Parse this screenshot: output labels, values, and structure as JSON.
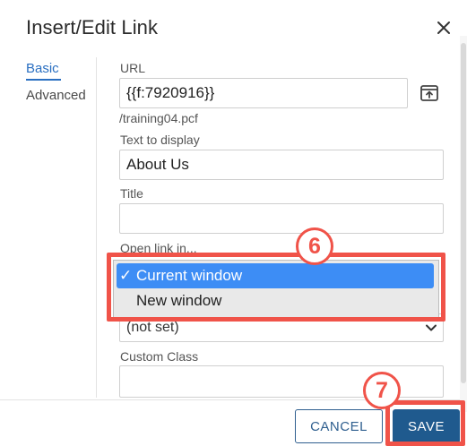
{
  "dialog": {
    "title": "Insert/Edit Link",
    "close_icon": "close-icon"
  },
  "nav": {
    "tabs": [
      {
        "label": "Basic",
        "active": true
      },
      {
        "label": "Advanced",
        "active": false
      }
    ]
  },
  "form": {
    "url": {
      "label": "URL",
      "value": "{{f:7920916}}",
      "path": "/training04.pcf",
      "browse_icon": "browse-file-icon"
    },
    "text_to_display": {
      "label": "Text to display",
      "value": "About Us"
    },
    "title_field": {
      "label": "Title",
      "value": ""
    },
    "open_link_in": {
      "label": "Open link in...",
      "options": [
        {
          "label": "Current window",
          "selected": true
        },
        {
          "label": "New window",
          "selected": false
        }
      ]
    },
    "rel_select": {
      "value": "(not set)"
    },
    "custom_class": {
      "label": "Custom Class",
      "value": ""
    }
  },
  "footer": {
    "cancel_label": "CANCEL",
    "save_label": "SAVE"
  },
  "annotations": {
    "step_a": "6",
    "step_b": "7",
    "color": "#f05349"
  },
  "colors": {
    "accent": "#2a6fc1",
    "primary_button": "#1f5a8e",
    "dropdown_highlight": "#3d8df5"
  }
}
